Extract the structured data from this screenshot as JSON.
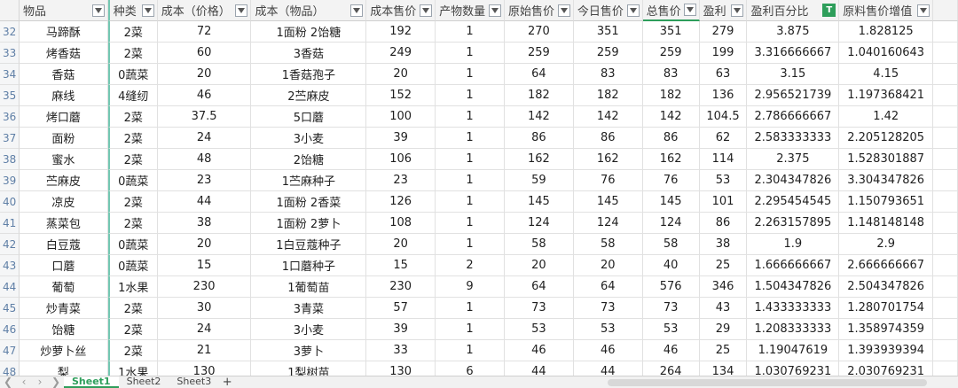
{
  "columns": [
    {
      "label": "物品"
    },
    {
      "label": "种类"
    },
    {
      "label": "成本（价格）"
    },
    {
      "label": "成本（物品）"
    },
    {
      "label": "成本售价"
    },
    {
      "label": "产物数量"
    },
    {
      "label": "原始售价"
    },
    {
      "label": "今日售价"
    },
    {
      "label": "总售价"
    },
    {
      "label": "盈利"
    },
    {
      "label": "盈利百分比"
    },
    {
      "label": "原料售价增值"
    }
  ],
  "rows": [
    {
      "num": "32",
      "cells": [
        "马蹄酥",
        "2菜",
        "72",
        "1面粉 2饴糖",
        "192",
        "1",
        "270",
        "351",
        "351",
        "279",
        "3.875",
        "1.828125"
      ]
    },
    {
      "num": "33",
      "cells": [
        "烤香菇",
        "2菜",
        "60",
        "3香菇",
        "249",
        "1",
        "259",
        "259",
        "259",
        "199",
        "3.316666667",
        "1.040160643"
      ]
    },
    {
      "num": "34",
      "cells": [
        "香菇",
        "0蔬菜",
        "20",
        "1香菇孢子",
        "20",
        "1",
        "64",
        "83",
        "83",
        "63",
        "3.15",
        "4.15"
      ]
    },
    {
      "num": "35",
      "cells": [
        "麻线",
        "4缝纫",
        "46",
        "2苎麻皮",
        "152",
        "1",
        "182",
        "182",
        "182",
        "136",
        "2.956521739",
        "1.197368421"
      ]
    },
    {
      "num": "36",
      "cells": [
        "烤口蘑",
        "2菜",
        "37.5",
        "5口蘑",
        "100",
        "1",
        "142",
        "142",
        "142",
        "104.5",
        "2.786666667",
        "1.42"
      ]
    },
    {
      "num": "37",
      "cells": [
        "面粉",
        "2菜",
        "24",
        "3小麦",
        "39",
        "1",
        "86",
        "86",
        "86",
        "62",
        "2.583333333",
        "2.205128205"
      ]
    },
    {
      "num": "38",
      "cells": [
        "蜜水",
        "2菜",
        "48",
        "2饴糖",
        "106",
        "1",
        "162",
        "162",
        "162",
        "114",
        "2.375",
        "1.528301887"
      ]
    },
    {
      "num": "39",
      "cells": [
        "苎麻皮",
        "0蔬菜",
        "23",
        "1苎麻种子",
        "23",
        "1",
        "59",
        "76",
        "76",
        "53",
        "2.304347826",
        "3.304347826"
      ]
    },
    {
      "num": "40",
      "cells": [
        "凉皮",
        "2菜",
        "44",
        "1面粉 2香菜",
        "126",
        "1",
        "145",
        "145",
        "145",
        "101",
        "2.295454545",
        "1.150793651"
      ]
    },
    {
      "num": "41",
      "cells": [
        "蒸菜包",
        "2菜",
        "38",
        "1面粉 2萝卜",
        "108",
        "1",
        "124",
        "124",
        "124",
        "86",
        "2.263157895",
        "1.148148148"
      ]
    },
    {
      "num": "42",
      "cells": [
        "白豆蔻",
        "0蔬菜",
        "20",
        "1白豆蔻种子",
        "20",
        "1",
        "58",
        "58",
        "58",
        "38",
        "1.9",
        "2.9"
      ]
    },
    {
      "num": "43",
      "cells": [
        "口蘑",
        "0蔬菜",
        "15",
        "1口蘑种子",
        "15",
        "2",
        "20",
        "20",
        "40",
        "25",
        "1.666666667",
        "2.666666667"
      ]
    },
    {
      "num": "44",
      "cells": [
        "葡萄",
        "1水果",
        "230",
        "1葡萄苗",
        "230",
        "9",
        "64",
        "64",
        "576",
        "346",
        "1.504347826",
        "2.504347826"
      ]
    },
    {
      "num": "45",
      "cells": [
        "炒青菜",
        "2菜",
        "30",
        "3青菜",
        "57",
        "1",
        "73",
        "73",
        "73",
        "43",
        "1.433333333",
        "1.280701754"
      ]
    },
    {
      "num": "46",
      "cells": [
        "饴糖",
        "2菜",
        "24",
        "3小麦",
        "39",
        "1",
        "53",
        "53",
        "53",
        "29",
        "1.208333333",
        "1.358974359"
      ]
    },
    {
      "num": "47",
      "cells": [
        "炒萝卜丝",
        "2菜",
        "21",
        "3萝卜",
        "33",
        "1",
        "46",
        "46",
        "46",
        "25",
        "1.19047619",
        "1.393939394"
      ]
    },
    {
      "num": "48",
      "cells": [
        "梨",
        "1水果",
        "130",
        "1梨树苗",
        "130",
        "6",
        "44",
        "44",
        "264",
        "134",
        "1.030769231",
        "2.030769231"
      ]
    }
  ],
  "sheets": [
    "Sheet1",
    "Sheet2",
    "Sheet3"
  ],
  "active_sheet": "Sheet1",
  "add_sheet_label": "+",
  "active_filter_mark": "T",
  "accent_color": "#2e9e5b"
}
